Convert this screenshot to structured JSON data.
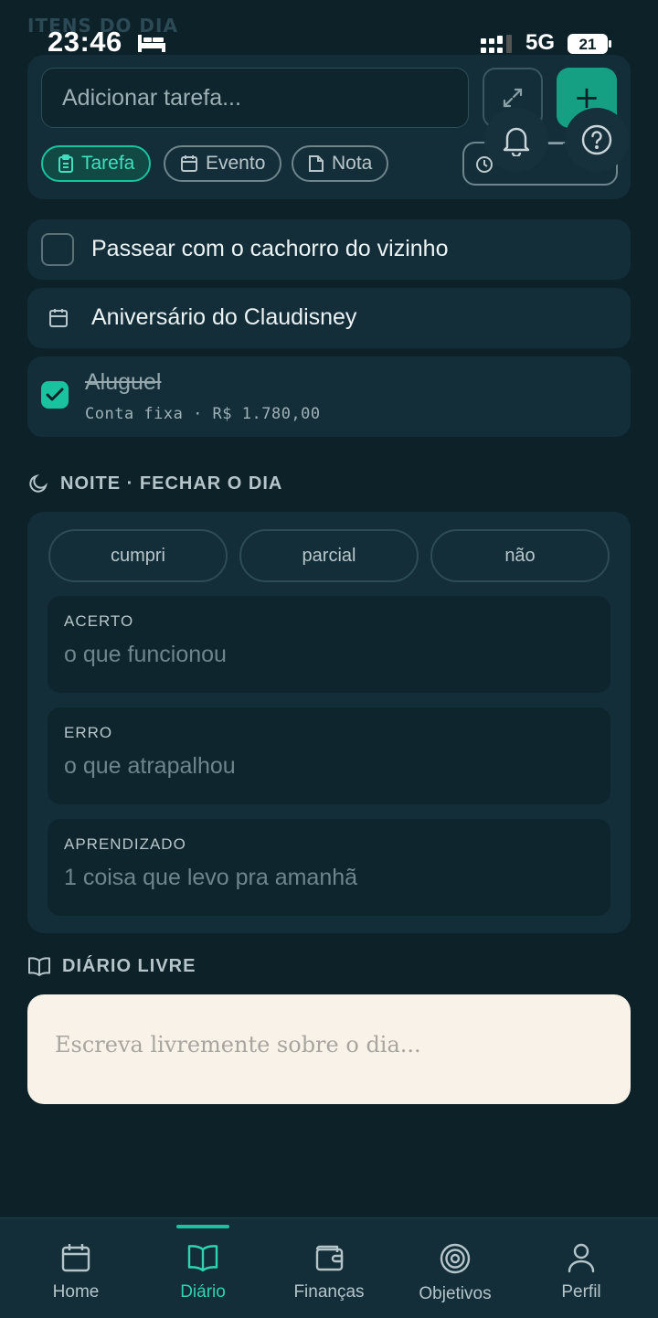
{
  "status": {
    "ghost_title": "ITENS DO DIA",
    "time": "23:46",
    "network": "5G",
    "battery": "21"
  },
  "composer": {
    "placeholder": "Adicionar tarefa...",
    "types": [
      {
        "label": "Tarefa",
        "icon": "clipboard-icon",
        "active": true
      },
      {
        "label": "Evento",
        "icon": "calendar-icon",
        "active": false
      },
      {
        "label": "Nota",
        "icon": "note-icon",
        "active": false
      }
    ]
  },
  "items": [
    {
      "kind": "task",
      "title": "Passear com o cachorro do vizinho",
      "checked": false
    },
    {
      "kind": "event",
      "title": "Aniversário do Claudisney"
    },
    {
      "kind": "bill",
      "title": "Aluguel",
      "subtitle": "Conta fixa · R$ 1.780,00",
      "checked": true
    }
  ],
  "night": {
    "title": "NOITE · FECHAR O DIA",
    "options": [
      "cumpri",
      "parcial",
      "não"
    ],
    "fields": [
      {
        "label": "ACERTO",
        "placeholder": "o que funcionou"
      },
      {
        "label": "ERRO",
        "placeholder": "o que atrapalhou"
      },
      {
        "label": "APRENDIZADO",
        "placeholder": "1 coisa que levo pra amanhã"
      }
    ]
  },
  "journal": {
    "title": "DIÁRIO LIVRE",
    "placeholder": "Escreva livremente sobre o dia..."
  },
  "nav": {
    "items": [
      {
        "label": "Home",
        "icon": "calendar-icon"
      },
      {
        "label": "Diário",
        "icon": "book-open-icon"
      },
      {
        "label": "Finanças",
        "icon": "wallet-icon"
      },
      {
        "label": "Objetivos",
        "icon": "target-icon"
      },
      {
        "label": "Perfil",
        "icon": "user-icon"
      }
    ],
    "active": "Diário"
  },
  "colors": {
    "background": "#0d2129",
    "card": "#132e38",
    "accent": "#19c3a0",
    "journal_bg": "#f8f2e8"
  }
}
